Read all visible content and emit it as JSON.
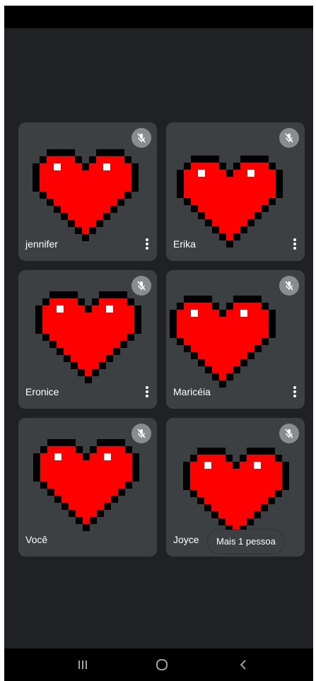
{
  "participants": [
    {
      "name": "jennifer",
      "muted": true,
      "has_menu": true
    },
    {
      "name": "Erika",
      "muted": true,
      "has_menu": true
    },
    {
      "name": "Eronice",
      "muted": true,
      "has_menu": true
    },
    {
      "name": "Maricéia",
      "muted": true,
      "has_menu": true
    },
    {
      "name": "Você",
      "muted": true,
      "has_menu": false
    },
    {
      "name": "Joyce",
      "muted": true,
      "has_menu": false
    }
  ],
  "more_people_label": "Mais 1 pessoa",
  "icons": {
    "mute": "mic-off-icon",
    "menu": "more-vert-icon",
    "avatar": "pixel-heart-icon",
    "nav_recents": "recents-icon",
    "nav_home": "home-icon",
    "nav_back": "back-icon"
  },
  "colors": {
    "background": "#202124",
    "tile": "#3c4043",
    "heart": "#ff0000",
    "heart_outline": "#000000",
    "mute_badge": "#8a8c8f"
  }
}
